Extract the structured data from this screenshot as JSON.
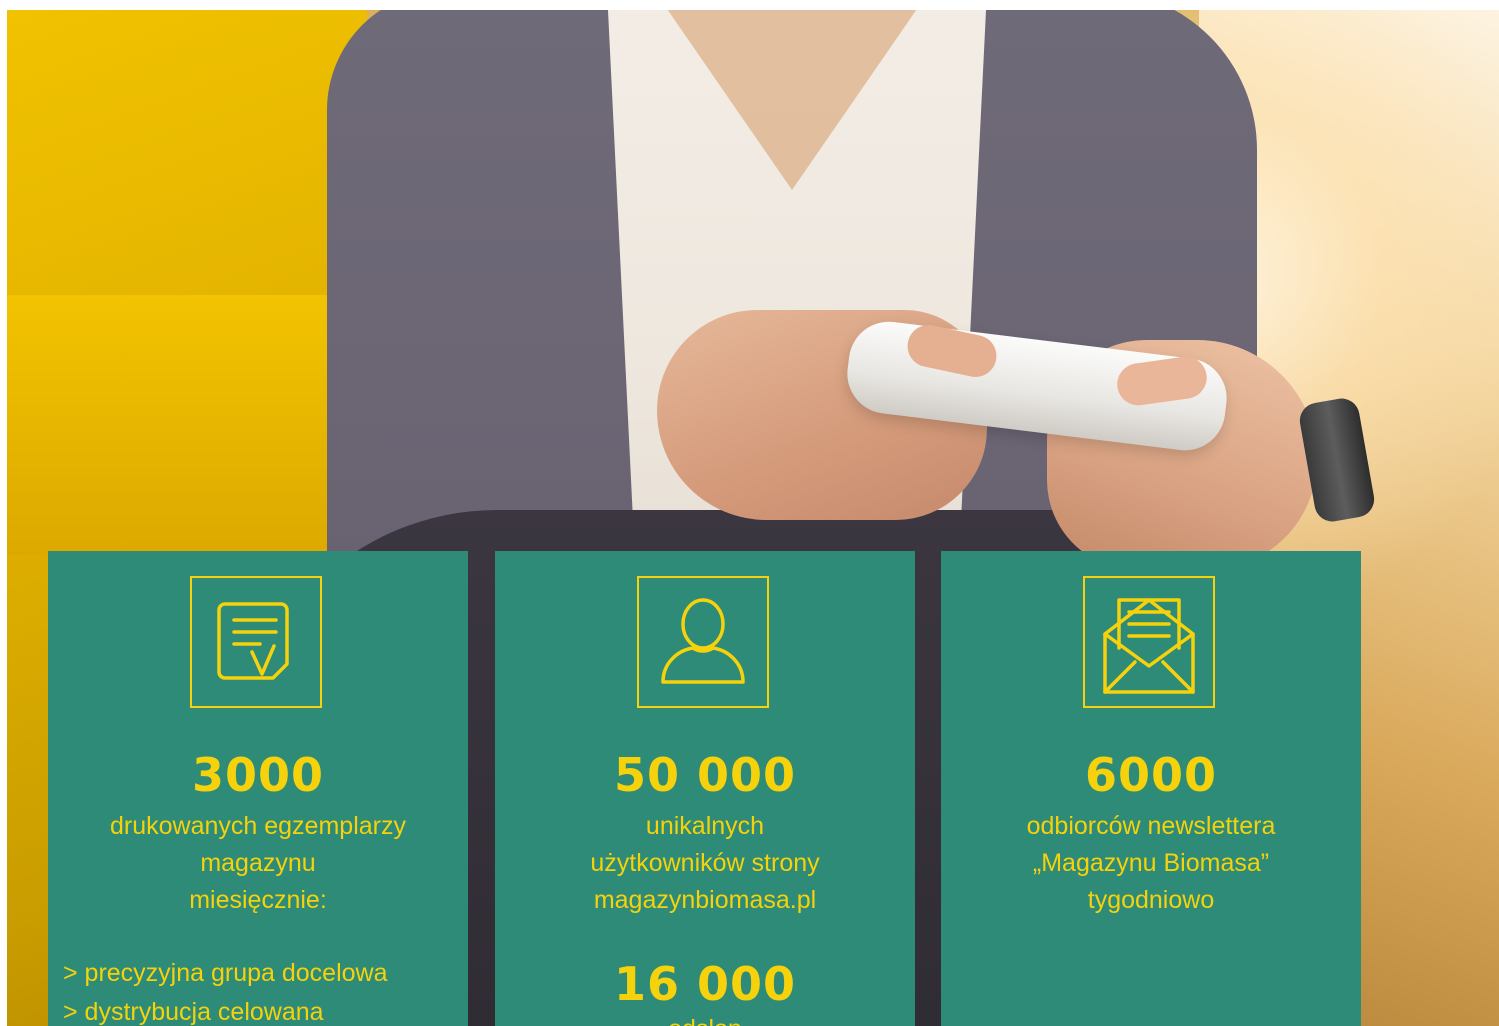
{
  "colors": {
    "card_background": "#2d8b77",
    "accent_yellow": "#f5d20c",
    "sofa_yellow": "#f0c200"
  },
  "background": {
    "description_icon": "photo-person-holding-smartphone"
  },
  "cards": [
    {
      "icon": "document-check-icon",
      "number": "3000",
      "lines": [
        "drukowanych egzemplarzy",
        "magazynu",
        "miesięcznie:"
      ],
      "bullets": [
        "> precyzyjna grupa docelowa",
        "> dystrybucja celowana"
      ]
    },
    {
      "icon": "user-icon",
      "number": "50 000",
      "lines": [
        "unikalnych",
        "użytkowników strony",
        "magazynbiomasa.pl"
      ],
      "secondary_number": "16 000",
      "secondary_caption": "odsłon"
    },
    {
      "icon": "envelope-letter-icon",
      "number": "6000",
      "lines": [
        "odbiorców newslettera",
        "„Magazynu Biomasa”",
        "tygodniowo"
      ]
    }
  ]
}
